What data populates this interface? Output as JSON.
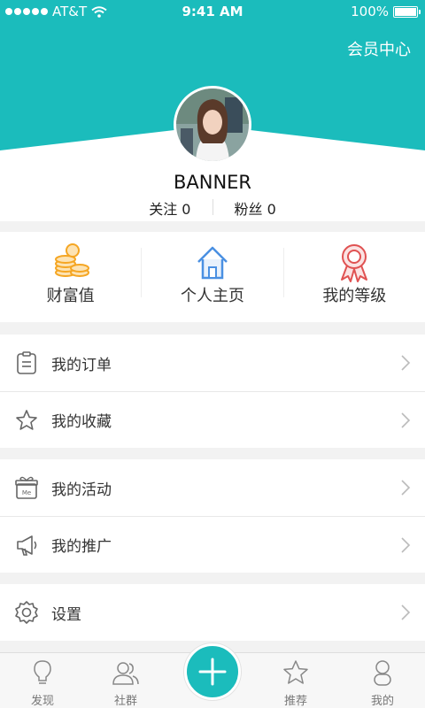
{
  "status_bar": {
    "carrier": "AT&T",
    "time": "9:41 AM",
    "battery": "100%"
  },
  "header": {
    "member_center": "会员中心"
  },
  "profile": {
    "name": "BANNER",
    "following": "关注 0",
    "followers": "粉丝 0"
  },
  "stats": [
    {
      "label": "财富值",
      "icon": "coins-icon"
    },
    {
      "label": "个人主页",
      "icon": "home-icon"
    },
    {
      "label": "我的等级",
      "icon": "ribbon-medal-icon"
    }
  ],
  "menu": {
    "orders": "我的订单",
    "favorites": "我的收藏",
    "activities": "我的活动",
    "promotion": "我的推广",
    "settings": "设置"
  },
  "tabbar": {
    "discover": "发现",
    "community": "社群",
    "recommend": "推荐",
    "mine": "我的"
  },
  "colors": {
    "accent": "#1bbcbc",
    "coins": "#f5a623",
    "home": "#4a90e2",
    "medal": "#e05252"
  }
}
